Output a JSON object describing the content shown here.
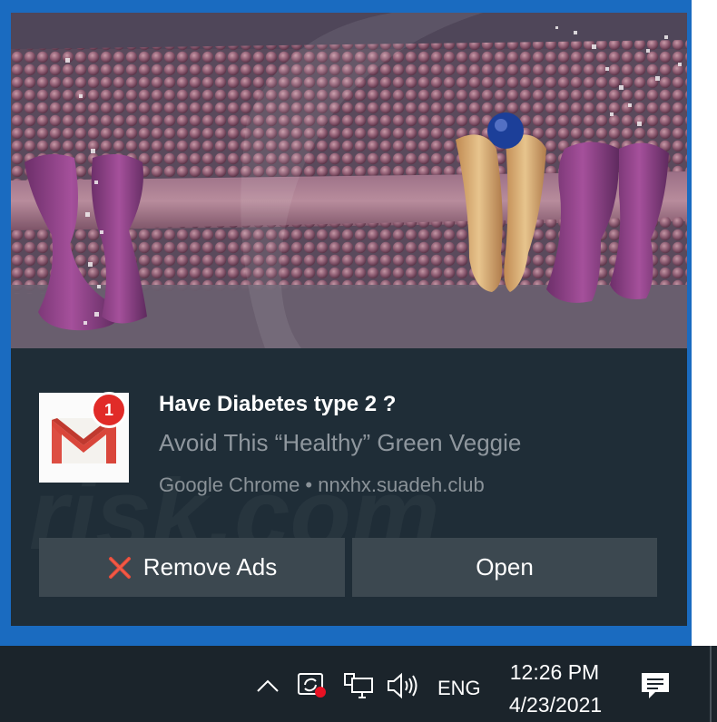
{
  "notification": {
    "title": "Have Diabetes type 2 ?",
    "subtitle": "Avoid This “Healthy” Green Veggie",
    "source": "Google Chrome • nnxhx.suadeh.club",
    "badge_count": "1",
    "app_icon": "gmail-icon",
    "watermark": "risk.com"
  },
  "buttons": {
    "remove_label": "Remove Ads",
    "open_label": "Open"
  },
  "taskbar": {
    "language": "ENG",
    "time": "12:26 PM",
    "date": "4/23/2021",
    "icons": [
      "chevron-up-icon",
      "network-sync-icon",
      "pc-network-icon",
      "volume-icon",
      "notification-center-icon"
    ]
  },
  "colors": {
    "frame_blue": "#1a6bc0",
    "toast_bg": "#1f2d37",
    "button_bg": "#3c4850",
    "badge_red": "#e12b28",
    "taskbar_bg": "#1b242b"
  }
}
